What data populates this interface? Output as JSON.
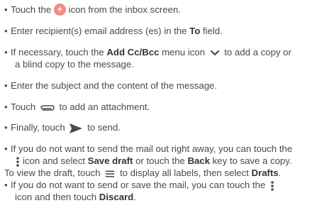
{
  "bullet": "•",
  "items": [
    {
      "a": "Touch the",
      "b": "icon from the inbox screen."
    },
    {
      "a": "Enter recipient(s) email address (es) in the",
      "bold1": "To",
      "b": "field."
    },
    {
      "a": "If necessary, touch the",
      "bold1": "Add Cc/Bcc",
      "b": "menu icon",
      "c": "to add a copy or",
      "d": "a blind copy to the message."
    },
    {
      "a": "Enter the subject and the content of the message."
    },
    {
      "a": "Touch",
      "b": "to add an attachment."
    },
    {
      "a": "Finally, touch",
      "b": "to send."
    },
    {
      "a": "If you do not want to send the mail out right away, you can touch the",
      "b": "icon and select",
      "bold1": "Save draft",
      "c": "or touch the",
      "bold2": "Back",
      "d": "key to save a copy.",
      "e": "To view the draft, touch",
      "f": "to display all labels, then select",
      "bold3": "Drafts",
      "g": "."
    },
    {
      "a": "If you do not want to send or save the mail, you can touch the",
      "b": "icon and then touch",
      "bold1": "Discard",
      "c": "."
    }
  ],
  "icons": {
    "compose": "plus-circle-icon",
    "dropdown": "chevron-down-icon",
    "attach": "paperclip-icon",
    "send": "send-arrow-icon",
    "more": "more-vertical-icon",
    "menu": "hamburger-menu-icon"
  },
  "colors": {
    "text": "#4a4a4a",
    "compose_icon": "#f28b82",
    "icon": "#4a4a4a"
  }
}
